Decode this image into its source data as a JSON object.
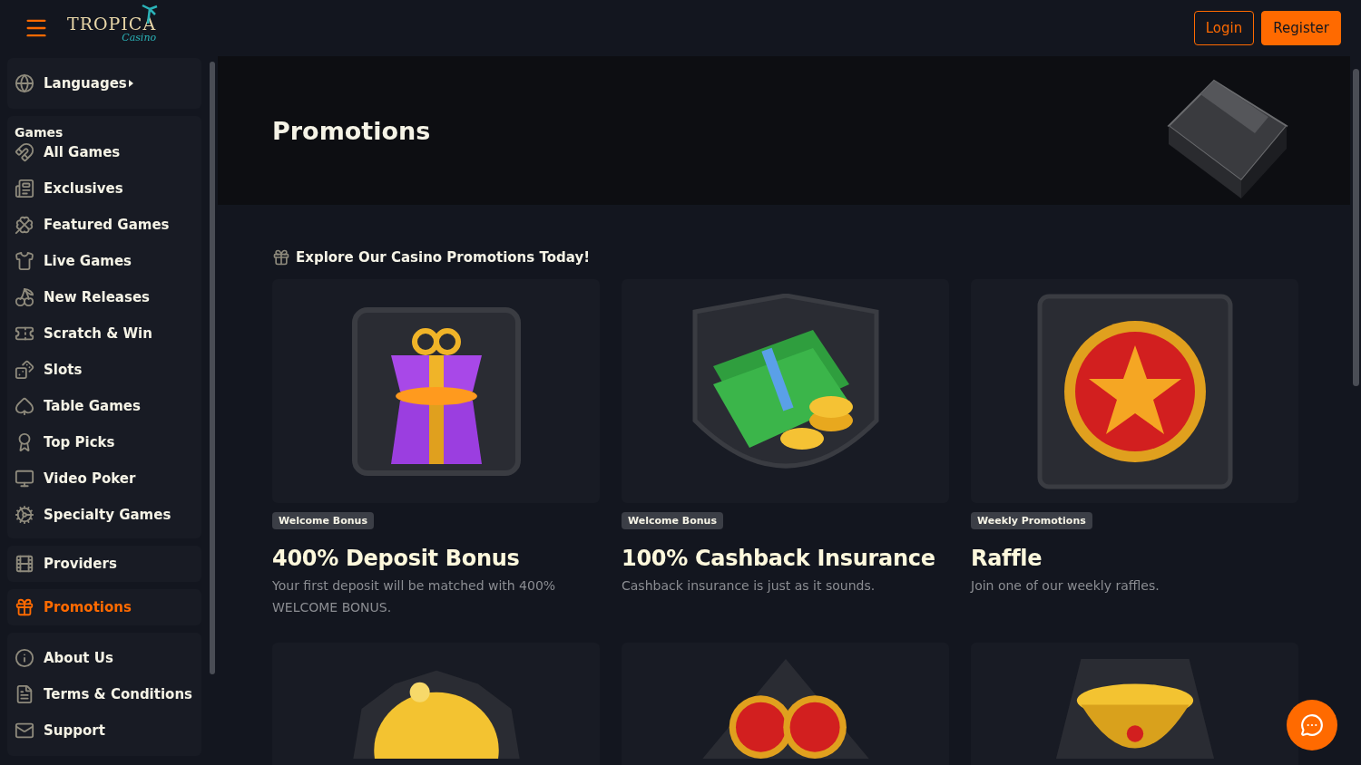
{
  "header": {
    "logo": {
      "title": "TROPICA",
      "subtitle": "Casino"
    },
    "login": "Login",
    "register": "Register"
  },
  "sidebar": {
    "languages": {
      "label": "Languages"
    },
    "games": {
      "heading": "Games",
      "items": [
        {
          "label": "All Games",
          "selected": false
        },
        {
          "label": "Exclusives",
          "selected": false
        },
        {
          "label": "Featured Games",
          "selected": false
        },
        {
          "label": "Live Games",
          "selected": false
        },
        {
          "label": "New Releases",
          "selected": false
        },
        {
          "label": "Scratch & Win",
          "selected": false
        },
        {
          "label": "Slots",
          "selected": false
        },
        {
          "label": "Table Games",
          "selected": false
        },
        {
          "label": "Top Picks",
          "selected": false
        },
        {
          "label": "Video Poker",
          "selected": false
        },
        {
          "label": "Specialty Games",
          "selected": false
        }
      ]
    },
    "providers": {
      "label": "Providers",
      "selected": false
    },
    "promotions": {
      "label": "Promotions",
      "selected": true
    },
    "info": [
      {
        "label": "About Us",
        "selected": false
      },
      {
        "label": "Terms & Conditions",
        "selected": false
      },
      {
        "label": "Support",
        "selected": false
      }
    ]
  },
  "hero": {
    "title": "Promotions"
  },
  "section": {
    "heading": "Explore Our Casino Promotions Today!"
  },
  "cards": [
    {
      "kind": "gift",
      "tag": "Welcome Bonus",
      "title": "400% Deposit Bonus",
      "description": "Your first deposit will be matched with 400% WELCOME BONUS."
    },
    {
      "kind": "cash",
      "tag": "Welcome Bonus",
      "title": "100% Cashback Insurance",
      "description": "Cashback insurance is just as it sounds."
    },
    {
      "kind": "medal",
      "tag": "Weekly Promotions",
      "title": "Raffle",
      "description": "Join one of our weekly raffles."
    },
    {
      "kind": "piggy"
    },
    {
      "kind": "coins"
    },
    {
      "kind": "trophy"
    }
  ]
}
